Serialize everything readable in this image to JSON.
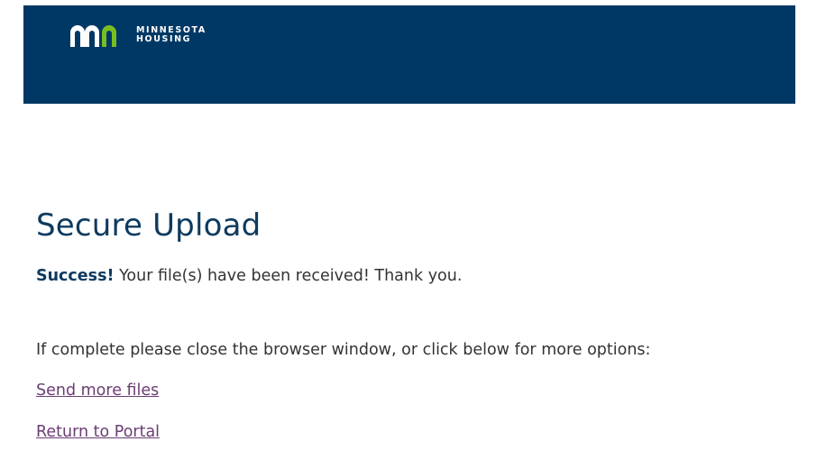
{
  "header": {
    "logo_line1": "MINNESOTA",
    "logo_line2": "HOUSING",
    "bg_color": "#003865",
    "logo_accent_color": "#78be20"
  },
  "main": {
    "title": "Secure Upload",
    "success_label": "Success!",
    "success_text": " Your file(s) have been received! Thank you.",
    "instructions": "If complete please close the browser window, or click below for more options:",
    "links": [
      {
        "label": "Send more files"
      },
      {
        "label": "Return to Portal"
      }
    ]
  }
}
